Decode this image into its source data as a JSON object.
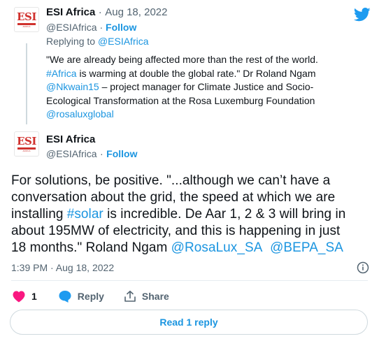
{
  "brand": {
    "accent": "#1b95e0",
    "like_color": "#f91880",
    "logo_color": "#d0312d"
  },
  "parent_tweet": {
    "avatar_logo": "ESI",
    "avatar_sub": "AFRICA",
    "name": "ESI Africa",
    "separator": "·",
    "date": "Aug 18, 2022",
    "handle": "@ESIAfrica",
    "follow": "Follow",
    "replying_prefix": "Replying to ",
    "replying_to": "@ESIAfrica",
    "text_line1": "\"We are already being affected more than the rest of the world.",
    "hashtag_africa": "#Africa",
    "text_line2_rest": " is warming at double the global rate.\" Dr Roland Ngam",
    "mention_nkwain": "@Nkwain15",
    "text_line3_rest": " – project manager for Climate Justice and Socio-",
    "text_line4": "Ecological Transformation at the Rosa Luxemburg Foundation",
    "mention_rosalux": "@rosaluxglobal"
  },
  "main_tweet": {
    "avatar_logo": "ESI",
    "avatar_sub": "AFRICA",
    "name": "ESI Africa",
    "handle": "@ESIAfrica",
    "separator": "·",
    "follow": "Follow",
    "line1": "For solutions, be positive. \"...although we can’t have a",
    "line2": "conversation about the grid, the speed at which we are",
    "line3_pre": "installing ",
    "hashtag_solar": "#solar",
    "line3_post": " is incredible. De Aar 1, 2 & 3 will bring in",
    "line4": "about 195MW of electricity, and this is happening in just",
    "line5_pre": "18 months.\" Roland Ngam ",
    "mention_rosalux_sa": "@RosaLux_SA",
    "mention_bepa": "@BEPA_SA",
    "timestamp": "1:39 PM · Aug 18, 2022",
    "info_icon": "info-icon"
  },
  "actions": {
    "like_count": "1",
    "reply_label": "Reply",
    "share_label": "Share"
  },
  "read_replies": "Read 1 reply",
  "icons": [
    "twitter-bird-icon",
    "heart-icon",
    "reply-bubble-icon",
    "share-icon",
    "info-icon"
  ]
}
